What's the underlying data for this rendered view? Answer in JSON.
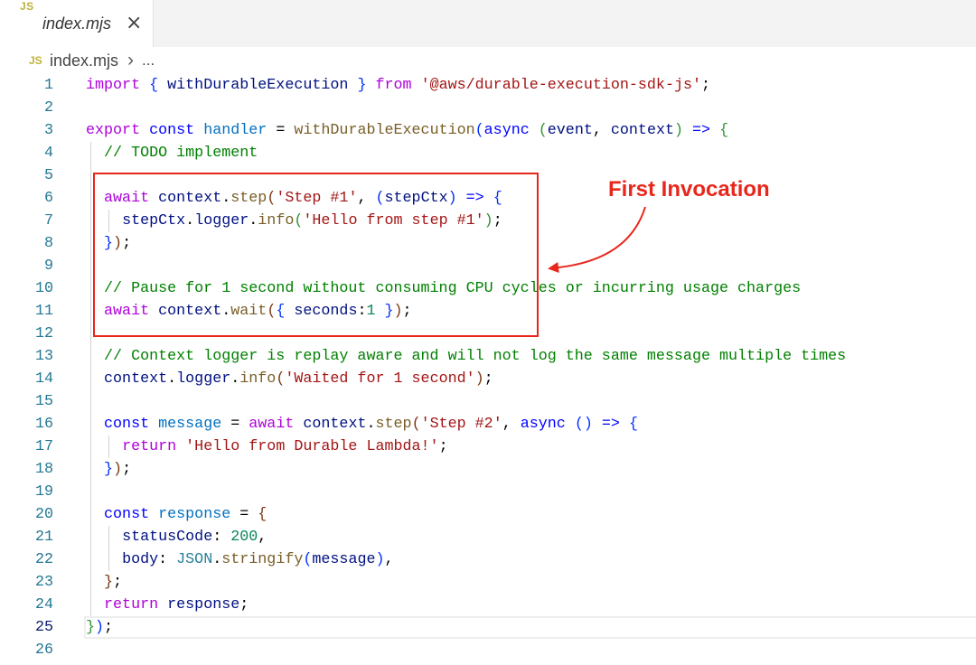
{
  "tab": {
    "icon_text": "JS",
    "icon": "js-file-icon",
    "label": "index.mjs",
    "close": "×"
  },
  "breadcrumb": {
    "icon_text": "JS",
    "icon": "js-file-icon",
    "file": "index.mjs",
    "separator": "›",
    "more": "..."
  },
  "editor": {
    "current_line": 25,
    "default_color": "#000000",
    "lines": [
      {
        "n": 1,
        "tokens": [
          [
            "import",
            "#af00db"
          ],
          [
            " "
          ],
          [
            "{",
            "#0431fa"
          ],
          [
            " "
          ],
          [
            "withDurableExecution",
            "#001080"
          ],
          [
            " "
          ],
          [
            "}",
            "#0431fa"
          ],
          [
            " "
          ],
          [
            "from",
            "#af00db"
          ],
          [
            " "
          ],
          [
            "'@aws/durable-execution-sdk-js'",
            "#a31515"
          ],
          [
            ";"
          ]
        ]
      },
      {
        "n": 2,
        "tokens": []
      },
      {
        "n": 3,
        "tokens": [
          [
            "export",
            "#af00db"
          ],
          [
            " "
          ],
          [
            "const",
            "#0000ff"
          ],
          [
            " "
          ],
          [
            "handler",
            "#0070c1"
          ],
          [
            " = "
          ],
          [
            "withDurableExecution",
            "#795e26"
          ],
          [
            "(",
            "#0431fa"
          ],
          [
            "async",
            "#0000ff"
          ],
          [
            " "
          ],
          [
            "(",
            "#319331"
          ],
          [
            "event",
            "#001080"
          ],
          [
            ", "
          ],
          [
            "context",
            "#001080"
          ],
          [
            ")",
            "#319331"
          ],
          [
            " "
          ],
          [
            "=>",
            "#0000ff"
          ],
          [
            " "
          ],
          [
            "{",
            "#319331"
          ]
        ]
      },
      {
        "n": 4,
        "tokens": [
          [
            "  "
          ],
          [
            "// TODO implement",
            "#008000"
          ]
        ]
      },
      {
        "n": 5,
        "tokens": []
      },
      {
        "n": 6,
        "tokens": [
          [
            "  "
          ],
          [
            "await",
            "#af00db"
          ],
          [
            " "
          ],
          [
            "context",
            "#001080"
          ],
          [
            "."
          ],
          [
            "step",
            "#795e26"
          ],
          [
            "(",
            "#7b3814"
          ],
          [
            "'Step #1'",
            "#a31515"
          ],
          [
            ", "
          ],
          [
            "(",
            "#0431fa"
          ],
          [
            "stepCtx",
            "#001080"
          ],
          [
            ")",
            "#0431fa"
          ],
          [
            " "
          ],
          [
            "=>",
            "#0000ff"
          ],
          [
            " "
          ],
          [
            "{",
            "#0431fa"
          ]
        ]
      },
      {
        "n": 7,
        "tokens": [
          [
            "    "
          ],
          [
            "stepCtx",
            "#001080"
          ],
          [
            "."
          ],
          [
            "logger",
            "#001080"
          ],
          [
            "."
          ],
          [
            "info",
            "#795e26"
          ],
          [
            "(",
            "#319331"
          ],
          [
            "'Hello from step #1'",
            "#a31515"
          ],
          [
            ")",
            "#319331"
          ],
          [
            ";"
          ]
        ]
      },
      {
        "n": 8,
        "tokens": [
          [
            "  "
          ],
          [
            "}",
            "#0431fa"
          ],
          [
            ")",
            "#7b3814"
          ],
          [
            ";"
          ]
        ]
      },
      {
        "n": 9,
        "tokens": []
      },
      {
        "n": 10,
        "tokens": [
          [
            "  "
          ],
          [
            "// Pause for 1 second without consuming CPU cycles or incurring usage charges",
            "#008000"
          ]
        ]
      },
      {
        "n": 11,
        "tokens": [
          [
            "  "
          ],
          [
            "await",
            "#af00db"
          ],
          [
            " "
          ],
          [
            "context",
            "#001080"
          ],
          [
            "."
          ],
          [
            "wait",
            "#795e26"
          ],
          [
            "(",
            "#7b3814"
          ],
          [
            "{",
            "#0431fa"
          ],
          [
            " "
          ],
          [
            "seconds",
            "#001080"
          ],
          [
            ":"
          ],
          [
            "1",
            "#098658"
          ],
          [
            " "
          ],
          [
            "}",
            "#0431fa"
          ],
          [
            ")",
            "#7b3814"
          ],
          [
            ";"
          ]
        ]
      },
      {
        "n": 12,
        "tokens": []
      },
      {
        "n": 13,
        "tokens": [
          [
            "  "
          ],
          [
            "// Context logger is replay aware and will not log the same message multiple times",
            "#008000"
          ]
        ]
      },
      {
        "n": 14,
        "tokens": [
          [
            "  "
          ],
          [
            "context",
            "#001080"
          ],
          [
            "."
          ],
          [
            "logger",
            "#001080"
          ],
          [
            "."
          ],
          [
            "info",
            "#795e26"
          ],
          [
            "(",
            "#7b3814"
          ],
          [
            "'Waited for 1 second'",
            "#a31515"
          ],
          [
            ")",
            "#7b3814"
          ],
          [
            ";"
          ]
        ]
      },
      {
        "n": 15,
        "tokens": []
      },
      {
        "n": 16,
        "tokens": [
          [
            "  "
          ],
          [
            "const",
            "#0000ff"
          ],
          [
            " "
          ],
          [
            "message",
            "#0070c1"
          ],
          [
            " = "
          ],
          [
            "await",
            "#af00db"
          ],
          [
            " "
          ],
          [
            "context",
            "#001080"
          ],
          [
            "."
          ],
          [
            "step",
            "#795e26"
          ],
          [
            "(",
            "#7b3814"
          ],
          [
            "'Step #2'",
            "#a31515"
          ],
          [
            ", "
          ],
          [
            "async",
            "#0000ff"
          ],
          [
            " "
          ],
          [
            "()",
            "#0431fa"
          ],
          [
            " "
          ],
          [
            "=>",
            "#0000ff"
          ],
          [
            " "
          ],
          [
            "{",
            "#0431fa"
          ]
        ]
      },
      {
        "n": 17,
        "tokens": [
          [
            "    "
          ],
          [
            "return",
            "#af00db"
          ],
          [
            " "
          ],
          [
            "'Hello from Durable Lambda!'",
            "#a31515"
          ],
          [
            ";"
          ]
        ]
      },
      {
        "n": 18,
        "tokens": [
          [
            "  "
          ],
          [
            "}",
            "#0431fa"
          ],
          [
            ")",
            "#7b3814"
          ],
          [
            ";"
          ]
        ]
      },
      {
        "n": 19,
        "tokens": []
      },
      {
        "n": 20,
        "tokens": [
          [
            "  "
          ],
          [
            "const",
            "#0000ff"
          ],
          [
            " "
          ],
          [
            "response",
            "#0070c1"
          ],
          [
            " = "
          ],
          [
            "{",
            "#7b3814"
          ]
        ]
      },
      {
        "n": 21,
        "tokens": [
          [
            "    "
          ],
          [
            "statusCode",
            "#001080"
          ],
          [
            ": "
          ],
          [
            "200",
            "#098658"
          ],
          [
            ","
          ]
        ]
      },
      {
        "n": 22,
        "tokens": [
          [
            "    "
          ],
          [
            "body",
            "#001080"
          ],
          [
            ": "
          ],
          [
            "JSON",
            "#267f99"
          ],
          [
            "."
          ],
          [
            "stringify",
            "#795e26"
          ],
          [
            "(",
            "#0431fa"
          ],
          [
            "message",
            "#001080"
          ],
          [
            ")",
            "#0431fa"
          ],
          [
            ","
          ]
        ]
      },
      {
        "n": 23,
        "tokens": [
          [
            "  "
          ],
          [
            "}",
            "#7b3814"
          ],
          [
            ";"
          ]
        ]
      },
      {
        "n": 24,
        "tokens": [
          [
            "  "
          ],
          [
            "return",
            "#af00db"
          ],
          [
            " "
          ],
          [
            "response",
            "#001080"
          ],
          [
            ";"
          ]
        ]
      },
      {
        "n": 25,
        "tokens": [
          [
            "}",
            "#319331"
          ],
          [
            ")",
            "#0431fa"
          ],
          [
            ";"
          ]
        ]
      },
      {
        "n": 26,
        "tokens": []
      }
    ]
  },
  "annotation": {
    "label": "First Invocation",
    "color": "#e8271c"
  }
}
